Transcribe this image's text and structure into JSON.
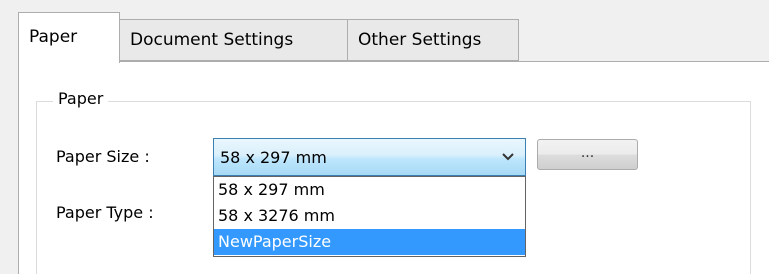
{
  "tabs": [
    {
      "label": "Paper",
      "active": true
    },
    {
      "label": "Document Settings",
      "active": false
    },
    {
      "label": "Other Settings",
      "active": false
    }
  ],
  "group": {
    "title": "Paper"
  },
  "paper_size": {
    "label": "Paper Size :",
    "value": "58 x 297 mm",
    "browse_label": "...",
    "options": [
      "58 x 297 mm",
      "58 x 3276 mm",
      "NewPaperSize"
    ],
    "highlighted_option": "NewPaperSize"
  },
  "paper_type": {
    "label": "Paper Type :"
  },
  "colors": {
    "selection": "#3399ff",
    "combo_border": "#3c7fb1"
  }
}
